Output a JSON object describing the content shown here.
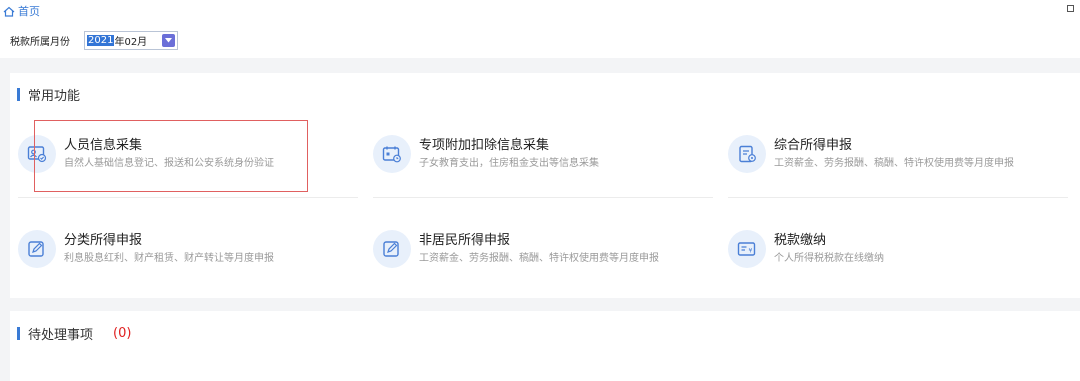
{
  "titlebar": {
    "home_label": "首页"
  },
  "toolbar": {
    "month_label": "税款所属月份",
    "year": "2021",
    "month_suffix": "年02月"
  },
  "common": {
    "title": "常用功能",
    "items": [
      {
        "name": "人员信息采集",
        "desc": "自然人基础信息登记、报送和公安系统身份验证",
        "icon": "id-card-icon"
      },
      {
        "name": "专项附加扣除信息采集",
        "desc": "子女教育支出，住房租金支出等信息采集",
        "icon": "calendar-icon"
      },
      {
        "name": "综合所得申报",
        "desc": "工资薪金、劳务报酬、稿酬、特许权使用费等月度申报",
        "icon": "document-icon"
      },
      {
        "name": "分类所得申报",
        "desc": "利息股息红利、财产租赁、财产转让等月度申报",
        "icon": "edit-icon"
      },
      {
        "name": "非居民所得申报",
        "desc": "工资薪金、劳务报酬、稿酬、特许权使用费等月度申报",
        "icon": "edit-icon"
      },
      {
        "name": "税款缴纳",
        "desc": "个人所得税税款在线缴纳",
        "icon": "payment-card-icon"
      }
    ]
  },
  "pending": {
    "title": "待处理事项",
    "count": "(0)"
  },
  "colors": {
    "accent": "#3a7bd5",
    "highlight": "#e06060",
    "count": "#e02020"
  }
}
